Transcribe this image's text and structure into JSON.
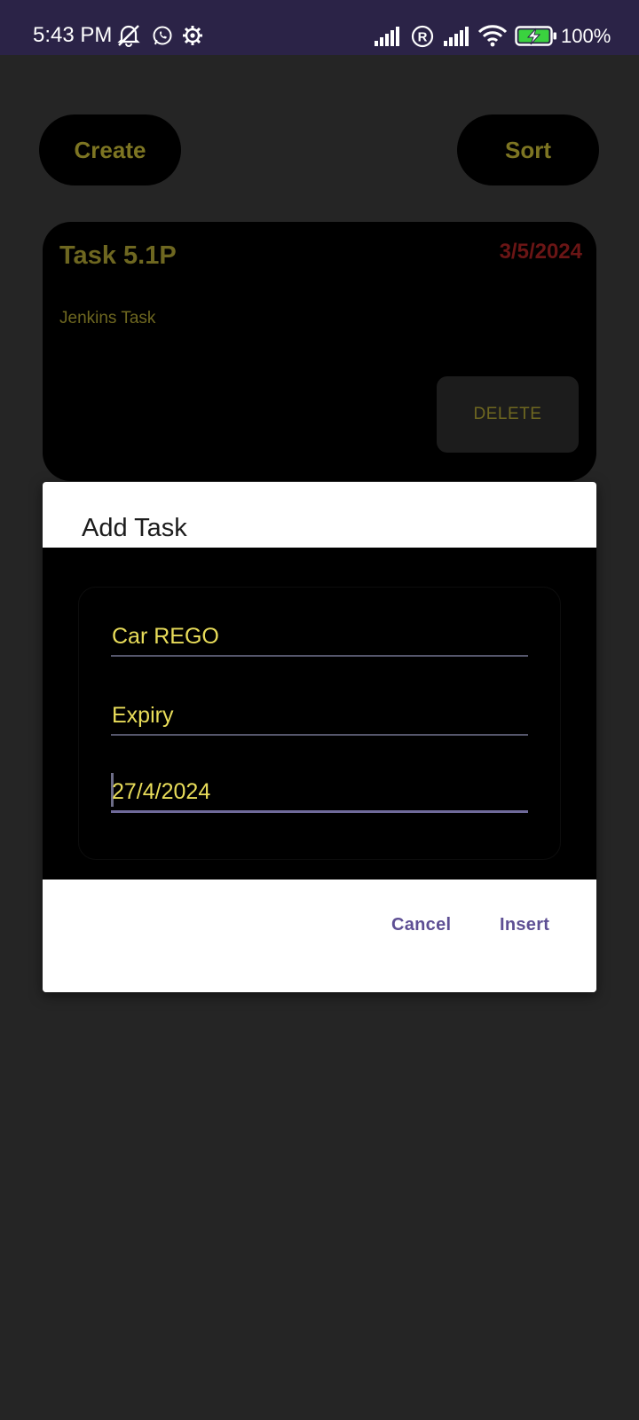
{
  "status_bar": {
    "time": "5:43 PM",
    "battery_percent": "100%",
    "icons": [
      "mute-icon",
      "whatsapp-icon",
      "settings-gear-icon",
      "signal-icon",
      "registered-icon",
      "signal-icon",
      "wifi-icon",
      "battery-charging-icon"
    ]
  },
  "toolbar": {
    "create_label": "Create",
    "sort_label": "Sort"
  },
  "task_card": {
    "title": "Task 5.1P",
    "date": "3/5/2024",
    "description": "Jenkins Task",
    "delete_label": "DELETE"
  },
  "dialog": {
    "title": "Add Task",
    "fields": [
      {
        "value": "Car REGO"
      },
      {
        "value": "Expiry"
      },
      {
        "value": "27/4/2024"
      }
    ],
    "cancel_label": "Cancel",
    "insert_label": "Insert"
  },
  "colors": {
    "status_bar_bg": "#2b2347",
    "app_bg": "#252525",
    "accent_text": "#e9dd5a",
    "dialog_button_text": "#5e4f94",
    "date_red": "#6a1515"
  }
}
